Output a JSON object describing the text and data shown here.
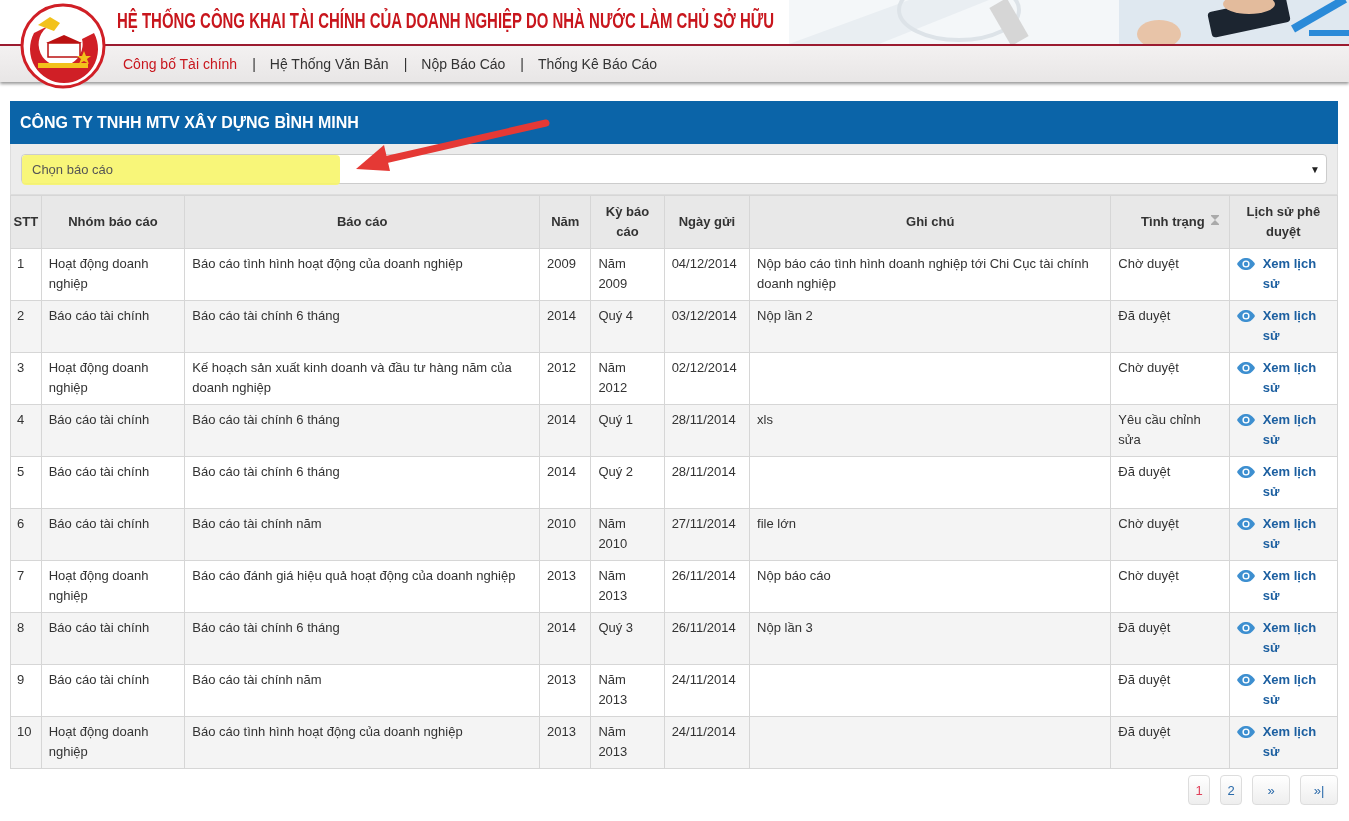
{
  "header": {
    "title": "HỆ THỐNG CÔNG KHAI TÀI CHÍNH CỦA DOANH NGHIỆP DO NHÀ NƯỚC LÀM CHỦ SỞ HỮU",
    "nav": [
      {
        "label": "Công bố Tài chính",
        "selected": true
      },
      {
        "label": "Hệ Thống Văn Bản",
        "selected": false
      },
      {
        "label": "Nộp Báo Cáo",
        "selected": false
      },
      {
        "label": "Thống Kê Báo Cáo",
        "selected": false
      }
    ],
    "separator": "|"
  },
  "panel": {
    "title": "CÔNG TY TNHH MTV XÂY DỰNG BÌNH MINH",
    "select": {
      "placeholder": "Chọn báo cáo",
      "arrow": "▼"
    }
  },
  "table": {
    "columns": [
      "STT",
      "Nhóm báo cáo",
      "Báo cáo",
      "Năm",
      "Kỳ báo cáo",
      "Ngày gửi",
      "Ghi chú",
      "Tình trạng",
      "Lịch sử phê duyệt"
    ],
    "rows": [
      {
        "stt": "1",
        "group": "Hoạt động doanh nghiệp",
        "report": "Báo cáo tình hình hoạt động của doanh nghiệp",
        "year": "2009",
        "period": "Năm 2009",
        "date": "04/12/2014",
        "note": "Nộp báo cáo tình hình doanh nghiệp tới Chi Cục tài chính doanh nghiệp",
        "status": "Chờ duyệt",
        "link": "Xem lịch sử"
      },
      {
        "stt": "2",
        "group": "Báo cáo tài chính",
        "report": "Báo cáo tài chính 6 tháng",
        "year": "2014",
        "period": "Quý 4",
        "date": "03/12/2014",
        "note": "Nộp lần 2",
        "status": "Đã duyệt",
        "link": "Xem lịch sử"
      },
      {
        "stt": "3",
        "group": "Hoạt động doanh nghiệp",
        "report": "Kế hoạch sản xuất kinh doanh và đầu tư hàng năm của doanh nghiệp",
        "year": "2012",
        "period": "Năm 2012",
        "date": "02/12/2014",
        "note": "",
        "status": "Chờ duyệt",
        "link": "Xem lịch sử"
      },
      {
        "stt": "4",
        "group": "Báo cáo tài chính",
        "report": "Báo cáo tài chính 6 tháng",
        "year": "2014",
        "period": "Quý 1",
        "date": "28/11/2014",
        "note": "xls",
        "status": "Yêu cầu chỉnh sửa",
        "link": "Xem lịch sử"
      },
      {
        "stt": "5",
        "group": "Báo cáo tài chính",
        "report": "Báo cáo tài chính 6 tháng",
        "year": "2014",
        "period": "Quý 2",
        "date": "28/11/2014",
        "note": "",
        "status": "Đã duyệt",
        "link": "Xem lịch sử"
      },
      {
        "stt": "6",
        "group": "Báo cáo tài chính",
        "report": "Báo cáo tài chính năm",
        "year": "2010",
        "period": "Năm 2010",
        "date": "27/11/2014",
        "note": "file lớn",
        "status": "Chờ duyệt",
        "link": "Xem lịch sử"
      },
      {
        "stt": "7",
        "group": "Hoạt động doanh nghiệp",
        "report": "Báo cáo đánh giá hiệu quả hoạt động của doanh nghiệp",
        "year": "2013",
        "period": "Năm 2013",
        "date": "26/11/2014",
        "note": "Nộp báo cáo",
        "status": "Chờ duyệt",
        "link": "Xem lịch sử"
      },
      {
        "stt": "8",
        "group": "Báo cáo tài chính",
        "report": "Báo cáo tài chính 6 tháng",
        "year": "2014",
        "period": "Quý 3",
        "date": "26/11/2014",
        "note": "Nộp lần 3",
        "status": "Đã duyệt",
        "link": "Xem lịch sử"
      },
      {
        "stt": "9",
        "group": "Báo cáo tài chính",
        "report": "Báo cáo tài chính năm",
        "year": "2013",
        "period": "Năm 2013",
        "date": "24/11/2014",
        "note": "",
        "status": "Đã duyệt",
        "link": "Xem lịch sử"
      },
      {
        "stt": "10",
        "group": "Hoạt động doanh nghiệp",
        "report": "Báo cáo tình hình hoạt động của doanh nghiệp",
        "year": "2013",
        "period": "Năm 2013",
        "date": "24/11/2014",
        "note": "",
        "status": "Đã duyệt",
        "link": "Xem lịch sử"
      }
    ]
  },
  "pagination": {
    "pages": [
      {
        "label": "1",
        "selected": true
      },
      {
        "label": "2",
        "selected": false
      }
    ],
    "next": "»",
    "last": "»|"
  }
}
